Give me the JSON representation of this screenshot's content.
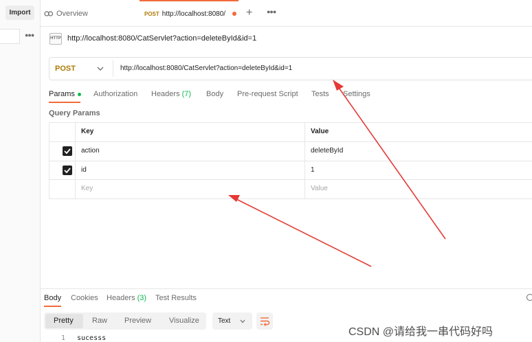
{
  "sidebar": {
    "import_label": "Import",
    "more_icon": "ellipsis-icon"
  },
  "tabs": {
    "overview_label": "Overview",
    "active_method": "POST",
    "active_url": "http://localhost:8080/",
    "unsaved_color": "#f26b3a"
  },
  "request": {
    "title": "http://localhost:8080/CatServlet?action=deleteById&id=1",
    "method": "POST",
    "url": "http://localhost:8080/CatServlet?action=deleteById&id=1",
    "method_color": "#ad7a03"
  },
  "request_tabs": {
    "params": "Params",
    "authorization": "Authorization",
    "headers": "Headers",
    "headers_count": "(7)",
    "body": "Body",
    "pre_request": "Pre-request Script",
    "tests": "Tests",
    "settings": "Settings"
  },
  "query_params": {
    "label": "Query Params",
    "col_key": "Key",
    "col_value": "Value",
    "rows": [
      {
        "key": "action",
        "value": "deleteById",
        "checked": true
      },
      {
        "key": "id",
        "value": "1",
        "checked": true
      }
    ],
    "placeholder_key": "Key",
    "placeholder_value": "Value"
  },
  "response_tabs": {
    "body": "Body",
    "cookies": "Cookies",
    "headers": "Headers",
    "headers_count": "(3)",
    "test_results": "Test Results"
  },
  "response": {
    "formats": [
      "Pretty",
      "Raw",
      "Preview",
      "Visualize"
    ],
    "active_format": "Pretty",
    "type": "Text",
    "line_number": "1",
    "content": "sucesss"
  },
  "watermark": "CSDN @请给我一串代码好吗",
  "colors": {
    "accent": "#f26b3a",
    "arrow": "#e53935",
    "success": "#0cbb52"
  }
}
